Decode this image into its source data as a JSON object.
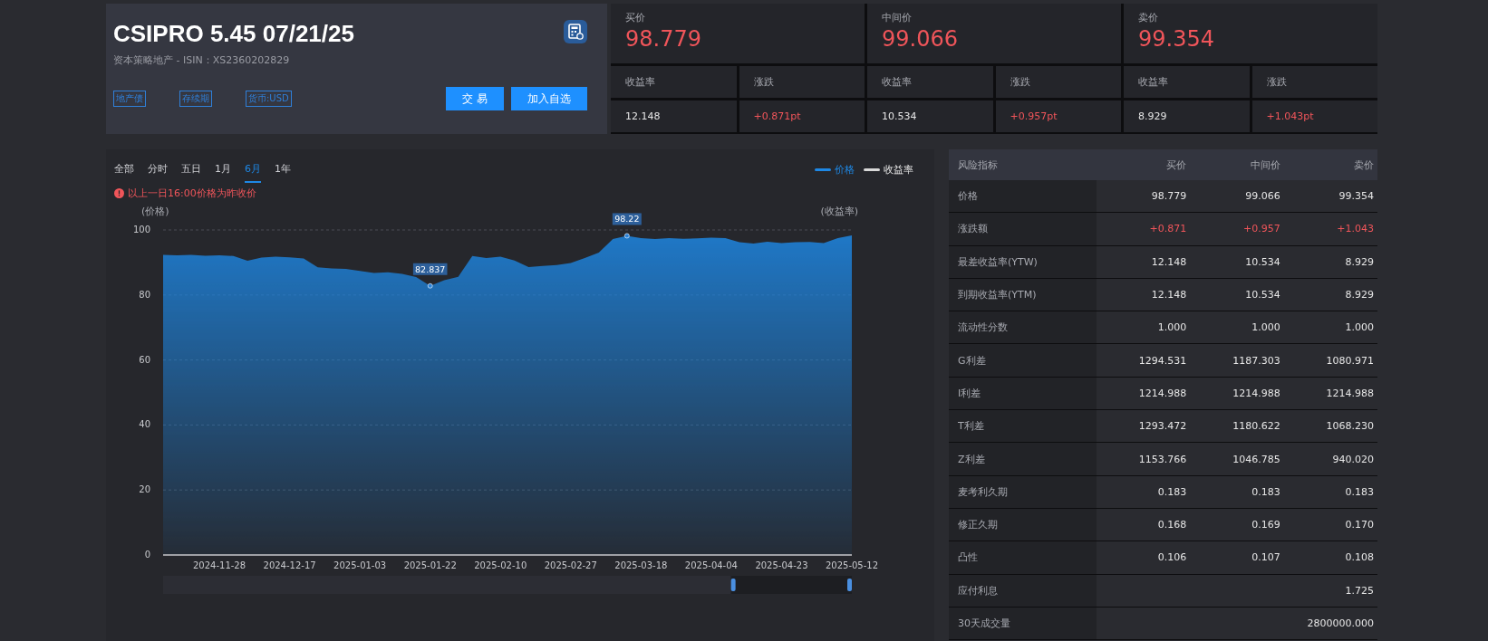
{
  "bond": {
    "title": "CSIPRO 5.45 07/21/25",
    "subtitle": "资本策略地产 - ISIN：XS2360202829",
    "tags": [
      "地产债",
      "存续期",
      "货币:USD"
    ],
    "buttons": [
      "交 易",
      "加入自选"
    ]
  },
  "quotes": [
    {
      "label": "买价",
      "price": "98.779",
      "yield_label": "收益率",
      "change_label": "涨跌",
      "yield": "12.148",
      "change": "+0.871pt"
    },
    {
      "label": "中间价",
      "price": "99.066",
      "yield_label": "收益率",
      "change_label": "涨跌",
      "yield": "10.534",
      "change": "+0.957pt"
    },
    {
      "label": "卖价",
      "price": "99.354",
      "yield_label": "收益率",
      "change_label": "涨跌",
      "yield": "8.929",
      "change": "+1.043pt"
    }
  ],
  "chart": {
    "ranges": [
      {
        "label": "全部",
        "selected": false
      },
      {
        "label": "分时",
        "selected": false
      },
      {
        "label": "五日",
        "selected": false
      },
      {
        "label": "1月",
        "selected": false
      },
      {
        "label": "6月",
        "selected": true
      },
      {
        "label": "1年",
        "selected": false
      }
    ],
    "legend": [
      {
        "label": "收益率",
        "color": "#d9d9d9"
      }
    ],
    "notice": "以上一日16:00价格为昨收价",
    "right_axis_label": "(收益率)",
    "chart_data": {
      "type": "area",
      "grid": true,
      "ylabel": "(价格)",
      "ylim": [
        0,
        100
      ],
      "yticks": [
        0,
        20,
        40,
        60,
        80,
        100
      ],
      "categories": [
        null,
        null,
        null,
        null,
        "2024-11-28",
        null,
        null,
        null,
        null,
        "2024-12-17",
        null,
        null,
        null,
        null,
        "2025-01-03",
        null,
        null,
        null,
        null,
        "2025-01-22",
        null,
        null,
        null,
        null,
        "2025-02-10",
        null,
        null,
        null,
        null,
        "2025-02-27",
        null,
        null,
        null,
        null,
        "2025-03-18",
        null,
        null,
        null,
        null,
        "2025-04-04",
        null,
        null,
        null,
        null,
        "2025-04-23",
        null,
        null,
        null,
        null,
        "2025-05-12"
      ],
      "series": [
        {
          "name": "价格",
          "color": "#1e88e5",
          "values": [
            92.3,
            92.2,
            92.3,
            92.1,
            92.2,
            92.0,
            90.5,
            91.5,
            91.8,
            91.6,
            91.2,
            88.5,
            88.2,
            88.0,
            87.4,
            86.8,
            87.0,
            86.5,
            85.5,
            82.8,
            84.5,
            85.6,
            92.0,
            91.4,
            91.8,
            90.6,
            88.6,
            88.9,
            89.2,
            89.8,
            91.4,
            93.0,
            97.2,
            98.2,
            97.5,
            97.2,
            97.5,
            97.3,
            97.4,
            97.6,
            97.5,
            96.2,
            95.8,
            96.4,
            96.0,
            96.2,
            96.3,
            96.0,
            97.5,
            98.3
          ]
        }
      ],
      "annotations": [
        {
          "y": 98.2,
          "text": "98.22"
        },
        {
          "y": 82.8,
          "text": "82.837"
        }
      ]
    },
    "zoom_handles": [
      {
        "level": 0.83
      },
      {
        "level": 1.0
      }
    ]
  },
  "risk_table": {
    "columns": [
      "风险指标",
      "买价",
      "中间价",
      "卖价"
    ],
    "rows": [
      {
        "kind": "normal",
        "label": "价格",
        "bid": "98.779",
        "mid": "99.066",
        "ask": "99.354"
      },
      {
        "kind": "change",
        "label": "涨跌额",
        "bid": "+0.871",
        "mid": "+0.957",
        "ask": "+1.043"
      },
      {
        "kind": "normal",
        "label": "最差收益率(YTW)",
        "bid": "12.148",
        "mid": "10.534",
        "ask": "8.929"
      },
      {
        "kind": "normal",
        "label": "到期收益率(YTM)",
        "bid": "12.148",
        "mid": "10.534",
        "ask": "8.929"
      },
      {
        "kind": "normal",
        "label": "流动性分数",
        "bid": "1.000",
        "mid": "1.000",
        "ask": "1.000"
      },
      {
        "kind": "normal",
        "label": "G利差",
        "bid": "1294.531",
        "mid": "1187.303",
        "ask": "1080.971"
      },
      {
        "kind": "normal",
        "label": "I利差",
        "bid": "1214.988",
        "mid": "1214.988",
        "ask": "1214.988"
      },
      {
        "kind": "normal",
        "label": "T利差",
        "bid": "1293.472",
        "mid": "1180.622",
        "ask": "1068.230"
      },
      {
        "kind": "normal",
        "label": "Z利差",
        "bid": "1153.766",
        "mid": "1046.785",
        "ask": "940.020"
      },
      {
        "kind": "normal",
        "label": "麦考利久期",
        "bid": "0.183",
        "mid": "0.183",
        "ask": "0.183"
      },
      {
        "kind": "normal",
        "label": "修正久期",
        "bid": "0.168",
        "mid": "0.169",
        "ask": "0.170"
      },
      {
        "kind": "normal",
        "label": "凸性",
        "bid": "0.106",
        "mid": "0.107",
        "ask": "0.108"
      },
      {
        "kind": "normal",
        "label": "应付利息",
        "ask": "1.725"
      },
      {
        "kind": "normal",
        "label": "30天成交量",
        "ask": "2800000.000"
      }
    ]
  }
}
